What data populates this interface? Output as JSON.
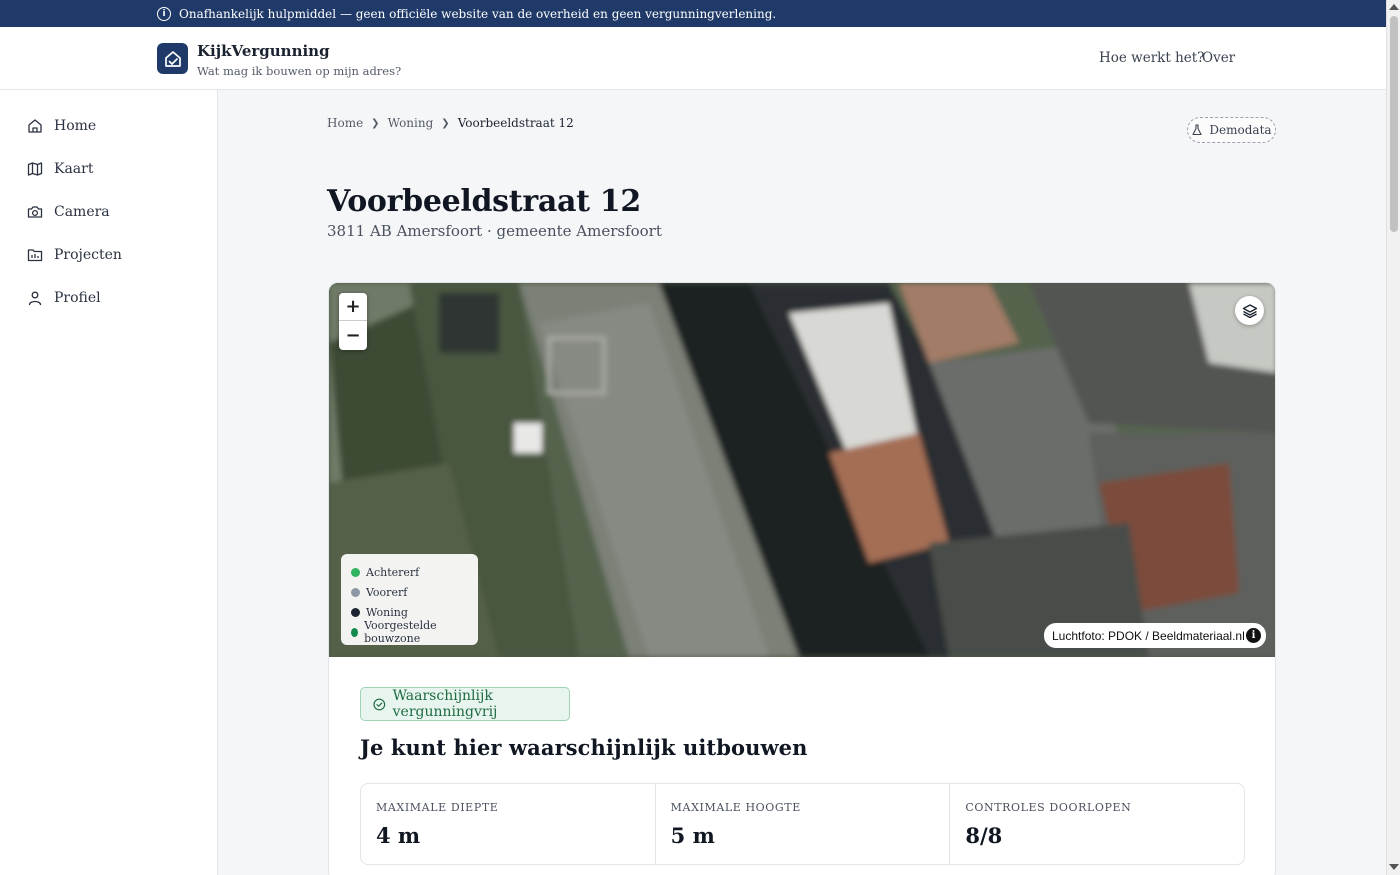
{
  "banner": {
    "text": "Onafhankelijk hulpmiddel — geen officiële website van de overheid en geen vergunningverlening."
  },
  "brand": {
    "name": "KijkVergunning",
    "tagline": "Wat mag ik bouwen op mijn adres?"
  },
  "topnav": {
    "how": "Hoe werkt het?",
    "about": "Over"
  },
  "sidebar": {
    "items": [
      {
        "label": "Home",
        "icon": "home-icon"
      },
      {
        "label": "Kaart",
        "icon": "map-icon"
      },
      {
        "label": "Camera",
        "icon": "camera-icon"
      },
      {
        "label": "Projecten",
        "icon": "folder-icon"
      },
      {
        "label": "Profiel",
        "icon": "user-icon"
      }
    ]
  },
  "breadcrumb": {
    "home": "Home",
    "section": "Woning",
    "current": "Voorbeeldstraat 12"
  },
  "demo_badge": "Demodata",
  "page": {
    "title": "Voorbeeldstraat 12",
    "subtitle": "3811 AB Amersfoort · gemeente Amersfoort"
  },
  "map": {
    "zoom_in": "+",
    "zoom_out": "−",
    "legend": [
      {
        "label": "Achtererf",
        "color": "#2fb35c"
      },
      {
        "label": "Voorerf",
        "color": "#8d96a6"
      },
      {
        "label": "Woning",
        "color": "#1e2433"
      },
      {
        "label": "Voorgestelde bouwzone",
        "color": "#128a4e"
      }
    ],
    "attribution": "Luchtfoto: PDOK / Beeldmateriaal.nl",
    "attribution_info": "i"
  },
  "result": {
    "status": "Waarschijnlijk vergunningvrij",
    "headline": "Je kunt hier waarschijnlijk uitbouwen",
    "stats": [
      {
        "label": "Maximale diepte",
        "value": "4 m"
      },
      {
        "label": "Maximale hoogte",
        "value": "5 m"
      },
      {
        "label": "Controles doorlopen",
        "value": "8/8"
      }
    ]
  },
  "colors": {
    "brand": "#1f3a68",
    "success": "#1e6b43",
    "success_bg": "#e8f5ee"
  }
}
